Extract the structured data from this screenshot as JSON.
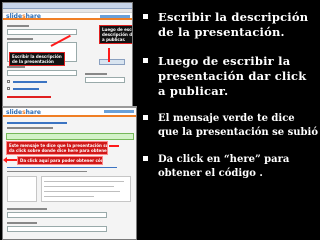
{
  "slide": {
    "background": "#000000",
    "bullets": [
      {
        "text": "Escribir la descripción de la presentación."
      },
      {
        "text": "Luego de escribir la presentación dar click a publicar."
      },
      {
        "text": "El mensaje verde te dice que la presentación se subió"
      },
      {
        "text": "Da click en “here”  para obtener el código ."
      }
    ]
  },
  "screenshot_top": {
    "callouts": {
      "description": [
        "Escribir la descripción",
        "de la presentación"
      ],
      "publish": [
        "Luego de escribir la",
        "descripción dar click",
        "a publicar."
      ]
    }
  },
  "screenshot_bottom": {
    "callouts": {
      "success": [
        "Este mensaje te dice que la presentación subió exitosamente.",
        "da click sobre donde dice here para obtener el código."
      ],
      "get_code": [
        "Da click aquí para poder obtener código."
      ]
    }
  },
  "colors": {
    "callout_red": "#d01818",
    "arrow": "#ff1a1a",
    "success_green": "#d3f2c8",
    "brand_orange": "#f07f25",
    "brand_blue": "#2a6cb4"
  }
}
